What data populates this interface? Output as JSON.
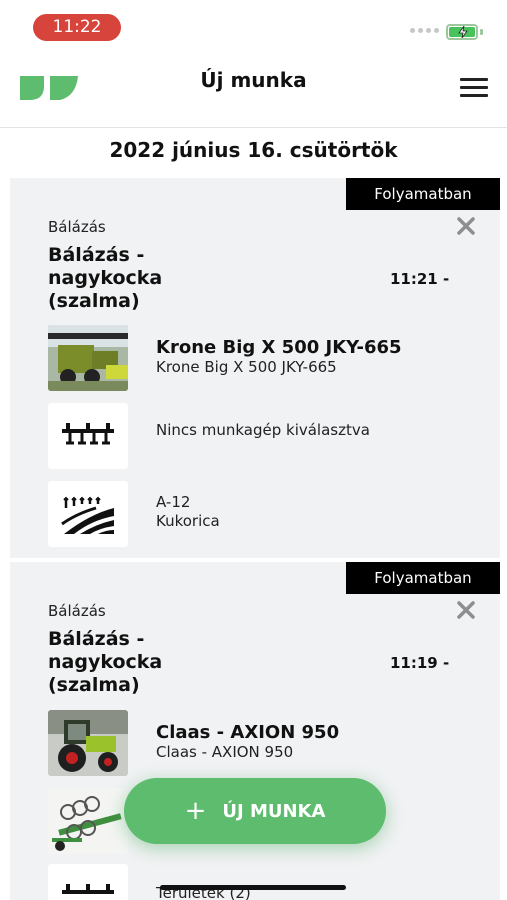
{
  "status_bar": {
    "time": "11:22"
  },
  "header": {
    "title": "Új munka"
  },
  "date": "2022 június 16. csütörtök",
  "jobs": [
    {
      "status": "Folyamatban",
      "category": "Bálázás",
      "name": "Bálázás - nagykocka (szalma)",
      "time": "11:21 -",
      "machine": {
        "title": "Krone Big X 500 JKY-665",
        "subtitle": "Krone Big X 500 JKY-665"
      },
      "implement": {
        "text": "Nincs munkagép kiválasztva"
      },
      "field": {
        "line1": "A-12",
        "line2": "Kukorica"
      }
    },
    {
      "status": "Folyamatban",
      "category": "Bálázás",
      "name": "Bálázás - nagykocka (szalma)",
      "time": "11:19 -",
      "machine": {
        "title": "Claas - AXION 950",
        "subtitle": "Claas - AXION 950"
      },
      "field": {
        "line1": "Területek (2)"
      }
    }
  ],
  "fab": {
    "plus": "+",
    "label": "ÚJ MUNKA"
  },
  "colors": {
    "accent": "#5dbc6e",
    "time_pill": "#d6443b",
    "badge": "#000000",
    "card_bg": "#f1f2f4"
  },
  "icons": [
    "signal-icon",
    "battery-icon",
    "logo-icon",
    "menu-icon",
    "close-icon",
    "implement-icon",
    "field-icon",
    "tractor-photo",
    "harvester-photo",
    "cultivator-photo"
  ]
}
